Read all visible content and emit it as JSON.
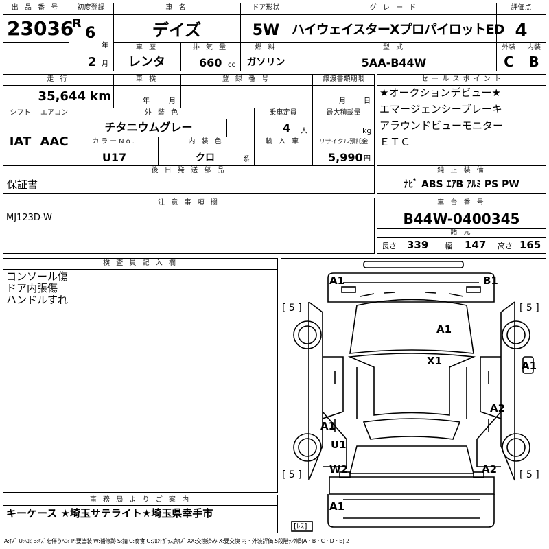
{
  "header": {
    "lot_label": "出 品 番 号",
    "lot_number": "23036",
    "first_reg_label": "初度登録",
    "era": "R",
    "year": "6",
    "year_unit": "年",
    "month": "2",
    "month_unit": "月",
    "car_name_label": "車 名",
    "car_name": "デイズ",
    "door_label": "ドア形状",
    "door": "5W",
    "grade_label": "グ レ ー ド",
    "grade": "ハイウェイスターXプロパイロットED",
    "score_label": "評価点",
    "score": "4",
    "history_label": "車 歴",
    "history": "レンタ",
    "displacement_label": "排 気 量",
    "displacement": "660",
    "displacement_unit": "cc",
    "fuel_label": "燃 料",
    "fuel": "ガソリン",
    "model_label": "型 式",
    "model": "5AA-B44W",
    "exterior_label": "外装",
    "interior_label": "内装",
    "exterior": "C",
    "interior": "B"
  },
  "details": {
    "mileage_label": "走 行",
    "mileage": "35,644 km",
    "inspection_label": "車 検",
    "inspection_year_unit": "年",
    "inspection_month_unit": "月",
    "reg_label": "登 録 番 号",
    "transfer_label": "譲渡書類期限",
    "transfer_month_unit": "月",
    "transfer_day_unit": "日",
    "shift_label": "シフト",
    "shift": "IAT",
    "ac_label": "エアコン",
    "ac": "AAC",
    "color_label": "外 装 色",
    "color": "チタニウムグレー",
    "capacity_label": "乗車定員",
    "capacity": "4",
    "capacity_unit": "人",
    "load_label": "最大積載量",
    "load_unit": "kg",
    "color_no_label": "カラーNo.",
    "color_no": "U17",
    "int_color_label": "内 装 色",
    "int_color": "クロ",
    "int_color_unit": "系",
    "import_label": "輸 入 車",
    "recycle_label": "リサイクル預託金",
    "recycle": "5,990",
    "recycle_unit": "円",
    "later_parts_label": "後 日 発 送 部 品",
    "later_parts": "保証書"
  },
  "sales_points": {
    "label": "セ ー ル ス ポ イ ン ト",
    "items": [
      "★オークションデビュー★",
      "エマージェンシーブレーキ",
      "アラウンドビューモニター",
      "ＥＴＣ"
    ]
  },
  "equipment": {
    "label": "純 正 装 備",
    "value": "ﾅﾋﾞ ABS ｴｱB ｱﾙﾐ PS PW"
  },
  "notes": {
    "label": "注 意 事 項 欄",
    "value": "MJ123D-W"
  },
  "chassis": {
    "label": "車 台 番 号",
    "value": "B44W-0400345",
    "spec_label": "諸 元",
    "length_label": "長さ",
    "length": "339",
    "width_label": "幅",
    "width": "147",
    "height_label": "高さ",
    "height": "165"
  },
  "inspector": {
    "label": "検 査 員 記 入 欄",
    "lines": [
      "コンソール傷",
      "ドア内張傷",
      "ハンドルすれ"
    ]
  },
  "office": {
    "label": "事 務 局 よ り ご 案 内",
    "value": "キーケース ★埼玉サテライト★埼玉県幸手市"
  },
  "diagram": {
    "tire_left_top": "[ 5 ]",
    "tire_right_top": "[ 5 ]",
    "tire_left_bottom": "[ 5 ]",
    "tire_right_bottom": "[ 5 ]",
    "spare": "[ﾚｽ]",
    "marks": {
      "front_left": "A1",
      "front_right": "B1",
      "hood": "A1",
      "roof": "X1",
      "right_front_fender": "A1",
      "right_side": "A2",
      "left_rear_door": "A1",
      "left_quarter": "U1",
      "left_rear": "W2",
      "right_rear": "A2",
      "rear_bumper": "A1"
    }
  },
  "legend": "A:ｷｽﾞ U:ﾍｺﾐ B:ｷｽﾞを伴うﾍｺﾐ P:要塗装 W:補修跡 S:錆 C:腐食 G:ﾌﾛﾝﾄｶﾞﾗｽ点ｷｽﾞ XX:交換済み X:要交換  内・外装評価  5段階ﾗﾝｸ順(A・B・C・D・E) 2"
}
